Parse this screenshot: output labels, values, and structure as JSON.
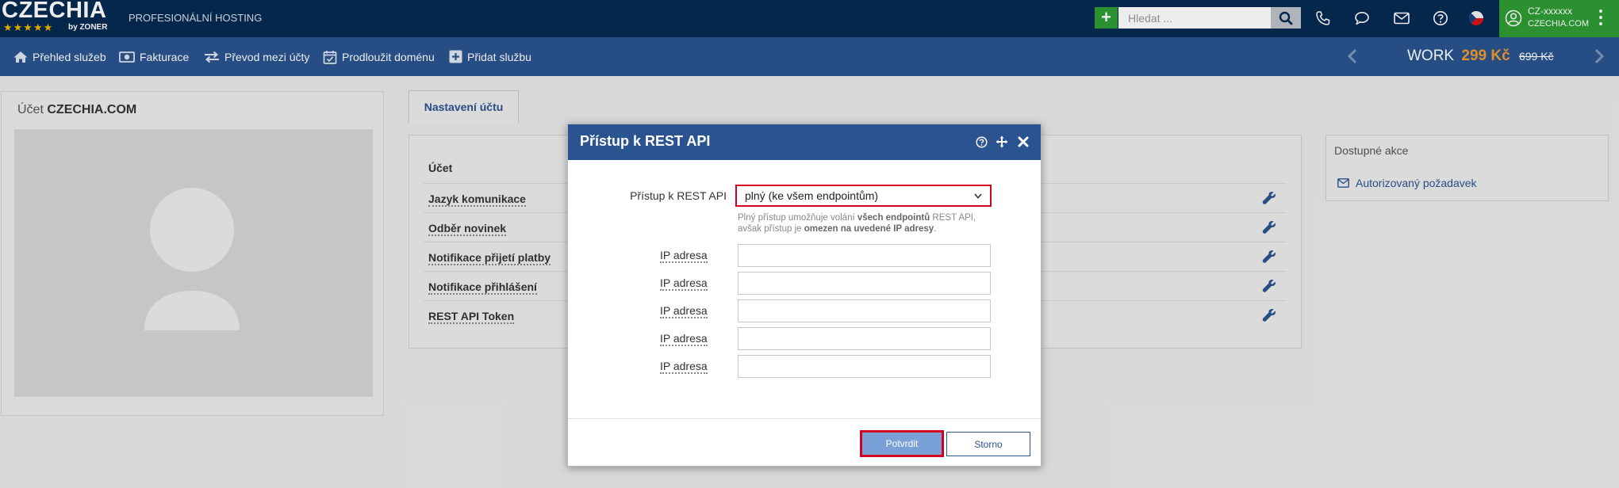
{
  "header": {
    "logo_text": "CZECHIA",
    "logo_stars": "★★★★★",
    "logo_by": "by ZONER",
    "tagline": "PROFESIONÁLNÍ HOSTING",
    "search_placeholder": "Hledat ...",
    "account_id": "CZ-xxxxxx",
    "account_domain": "CZECHIA.COM"
  },
  "nav": {
    "items": [
      {
        "label": "Přehled služeb",
        "icon": "home-icon"
      },
      {
        "label": "Fakturace",
        "icon": "money-icon"
      },
      {
        "label": "Převod mezi účty",
        "icon": "exchange-icon"
      },
      {
        "label": "Prodloužit doménu",
        "icon": "calendar-check-icon"
      },
      {
        "label": "Přidat službu",
        "icon": "plus-square-icon"
      }
    ],
    "promo": {
      "name": "WORK",
      "price": "299 Kč",
      "old_price": "699 Kč"
    }
  },
  "account_panel": {
    "prefix": "Účet",
    "name": "CZECHIA.COM"
  },
  "tabs": [
    {
      "label": "Nastavení účtu"
    }
  ],
  "settings": {
    "header": "Účet",
    "rows": [
      {
        "label": "Jazyk komunikace"
      },
      {
        "label": "Odběr novinek"
      },
      {
        "label": "Notifikace přijetí platby"
      },
      {
        "label": "Notifikace přihlášení"
      },
      {
        "label": "REST API Token"
      }
    ]
  },
  "actions": {
    "title": "Dostupné akce",
    "link": "Autorizovaný požadavek"
  },
  "modal": {
    "title": "Přístup k REST API",
    "api_label": "Přístup k REST API",
    "api_value": "plný (ke všem endpointům)",
    "help_1": "Plný přístup umožňuje volání ",
    "help_2": "všech endpointů",
    "help_3": " REST API, avšak přístup je ",
    "help_4": "omezen na uvedené IP adresy",
    "help_5": ".",
    "ip_fields": [
      {
        "label": "IP adresa",
        "value": ""
      },
      {
        "label": "IP adresa",
        "value": ""
      },
      {
        "label": "IP adresa",
        "value": ""
      },
      {
        "label": "IP adresa",
        "value": ""
      },
      {
        "label": "IP adresa",
        "value": ""
      }
    ],
    "confirm_label": "Potvrdit",
    "cancel_label": "Storno"
  },
  "colors": {
    "topbar": "#062a52",
    "navbar": "#2a5390",
    "accent_green": "#2e9b34",
    "price_orange": "#f39a2d",
    "highlight_red": "#d4001f"
  }
}
